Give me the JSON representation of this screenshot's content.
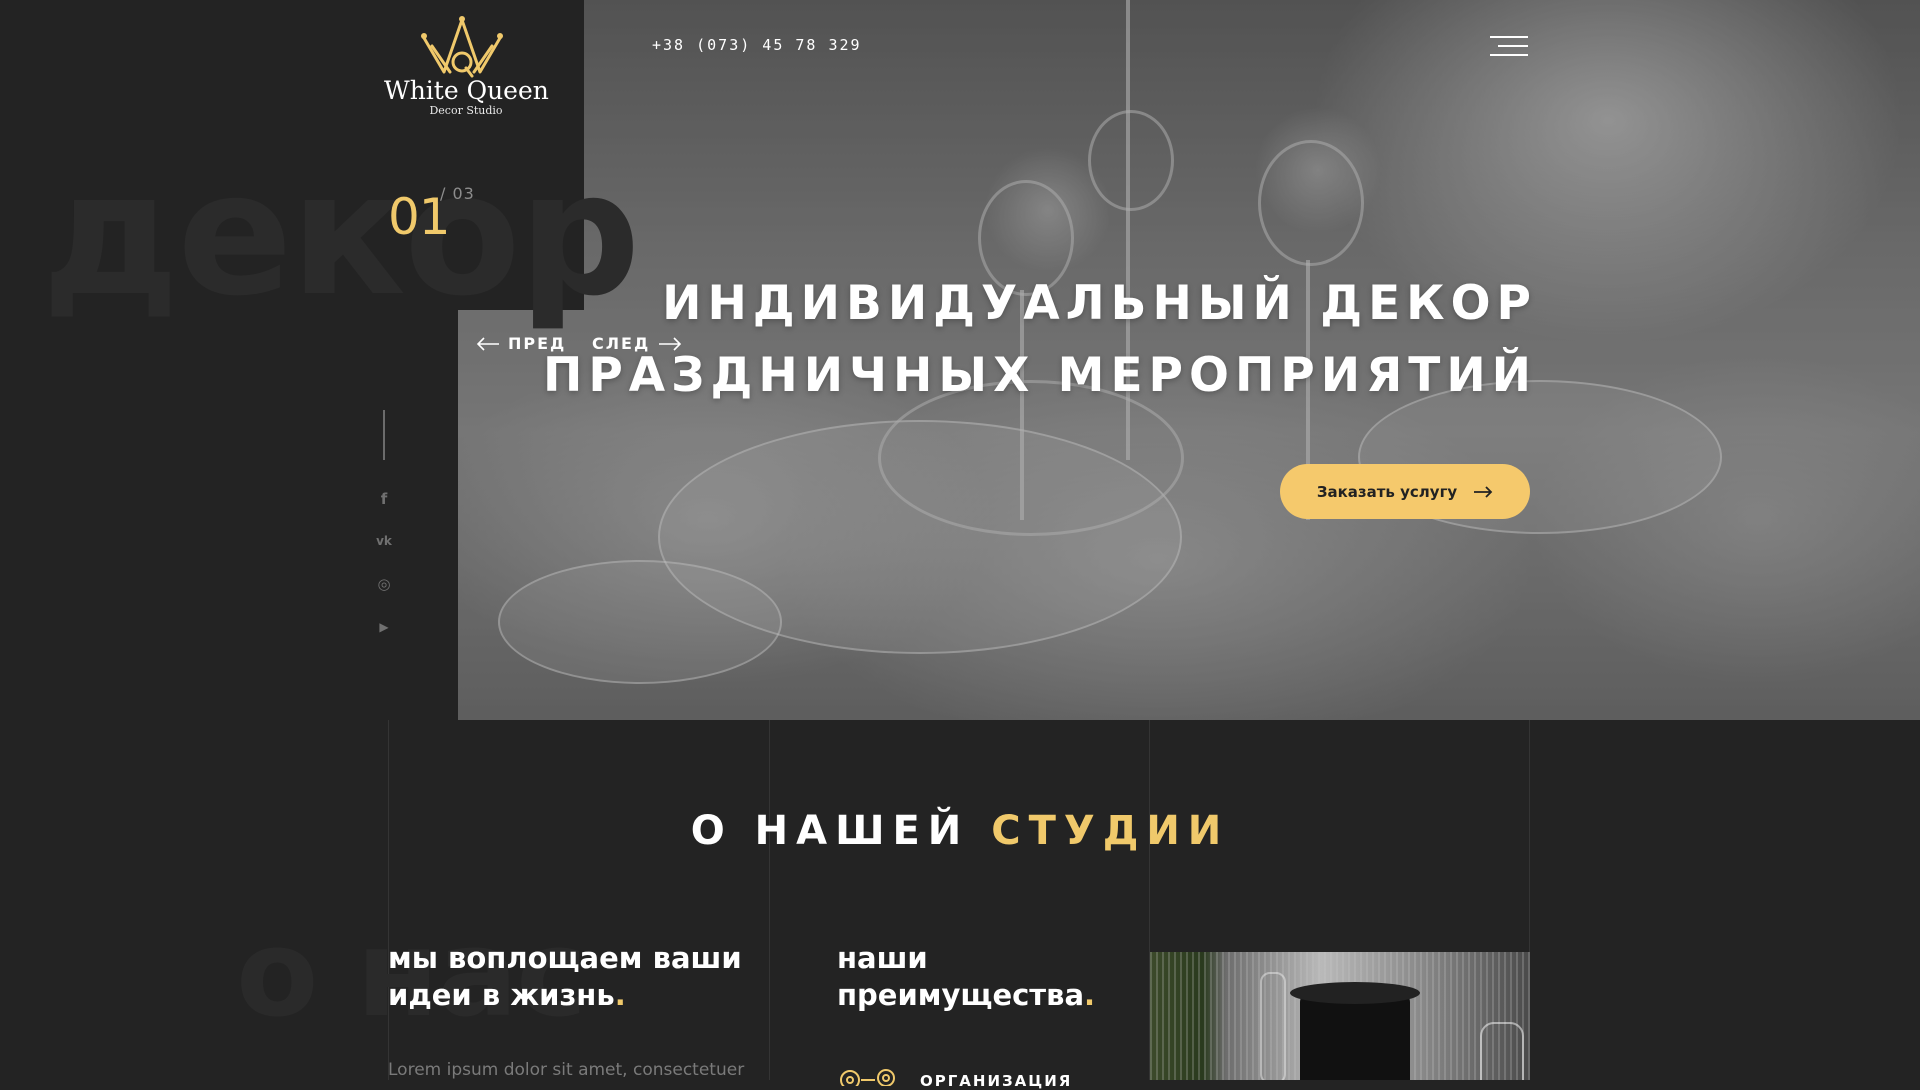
{
  "brand": {
    "name": "White Queen",
    "subtitle": "Decor Studio"
  },
  "header": {
    "phone": "+38 (073) 45 78 329",
    "menu_icon": "hamburger-icon"
  },
  "hero": {
    "bg_word": "декор",
    "slide_current": "01",
    "slide_total": "/ 03",
    "prev_label": "ПРЕД",
    "next_label": "СЛЕД",
    "title_line1": "ИНДИВИДУАЛЬНЫЙ ДЕКОР",
    "title_line2": "ПРАЗДНИЧНЫХ МЕРОПРИЯТИЙ",
    "cta_label": "Заказать услугу"
  },
  "social": [
    {
      "icon": "facebook-icon",
      "glyph": "f"
    },
    {
      "icon": "vk-icon",
      "glyph": "vk"
    },
    {
      "icon": "instagram-icon",
      "glyph": "◎"
    },
    {
      "icon": "youtube-icon",
      "glyph": "▶"
    }
  ],
  "about": {
    "bg_word": "о нас",
    "title_white": "О НАШЕЙ",
    "title_accent": "СТУДИИ",
    "col1_heading_line1": "мы воплощаем ваши",
    "col1_heading_line2": "идеи в жизнь",
    "col1_text": "Lorem ipsum dolor sit amet, consectetuer",
    "col2_heading_line1": "наши",
    "col2_heading_line2": "преимущества",
    "dot": ".",
    "adv1_label": "ОРГАНИЗАЦИЯ",
    "adv1_icon": "gears-icon"
  },
  "colors": {
    "accent": "#f0c96b",
    "cta": "#f5c96c",
    "background": "#232323"
  }
}
